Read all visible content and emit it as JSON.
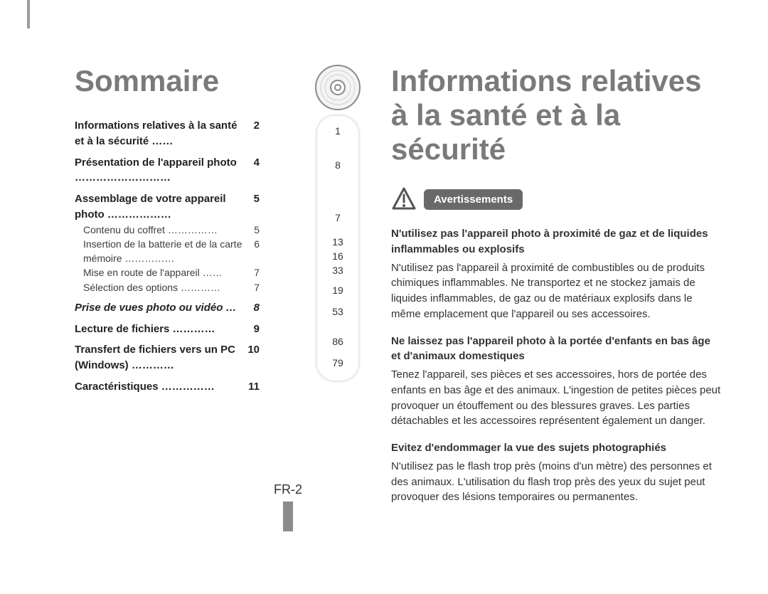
{
  "headings": {
    "leftTitle": "Sommaire",
    "rightTitle": "Informations relatives à la santé et à la sécurité"
  },
  "toc": {
    "ch1": {
      "label": "Informations relatives à la santé et à la sécurité …… ",
      "page": "2"
    },
    "ch2": {
      "label": "Présentation de l'appareil photo ……………………… ",
      "page": "4"
    },
    "ch3": {
      "label": "Assemblage de votre appareil photo ……………… ",
      "page": "5"
    },
    "s31": {
      "label": "Contenu du coffret    ……………",
      "page": "5"
    },
    "s32": {
      "label": "Insertion de la batterie et de la carte mémoire ……………",
      "page": "6"
    },
    "s33": {
      "label": "Mise en route de l'appareil  ……",
      "page": "7"
    },
    "s34": {
      "label": "Sélection des options …………",
      "page": "7"
    },
    "ch4": {
      "label": "Prise de vues photo ou vidéo …",
      "page": "8"
    },
    "ch5": {
      "label": "Lecture de fichiers ………… ",
      "page": "9"
    },
    "ch6": {
      "label": "Transfert de fichiers vers un PC (Windows)    …………",
      "page": "10"
    },
    "ch7": {
      "label": "Caractéristiques …………… ",
      "page": "11"
    }
  },
  "refPages": {
    "r1": "1",
    "r2": "8",
    "r3": "7",
    "r4": "13",
    "r5": "16",
    "r6": "33",
    "r7": "19",
    "r8": "53",
    "r9": "86",
    "r10": "79"
  },
  "warnLabel": "Avertissements",
  "warnings": {
    "w1h": "N'utilisez pas l'appareil photo à proximité de gaz et de liquides inflammables ou explosifs",
    "w1p": "N'utilisez pas l'appareil à proximité de combustibles ou de produits chimiques inflammables. Ne transportez et ne stockez jamais de liquides inflammables, de gaz ou de matériaux explosifs dans le même emplacement que l'appareil ou ses accessoires.",
    "w2h": "Ne laissez pas l'appareil photo à la portée d'enfants en bas âge et d'animaux domestiques",
    "w2p": "Tenez l'appareil, ses pièces et ses accessoires, hors de portée des enfants en bas âge et des animaux. L'ingestion de petites pièces peut provoquer un étouffement ou des blessures graves. Les parties détachables et les accessoires représentent également un danger.",
    "w3h": "Evitez d'endommager la vue des sujets photographiés",
    "w3p": "N'utilisez pas le flash trop près (moins d'un mètre) des personnes et des animaux. L'utilisation du flash trop près des yeux du sujet peut provoquer des lésions temporaires ou permanentes."
  },
  "pageNumber": "FR-2"
}
